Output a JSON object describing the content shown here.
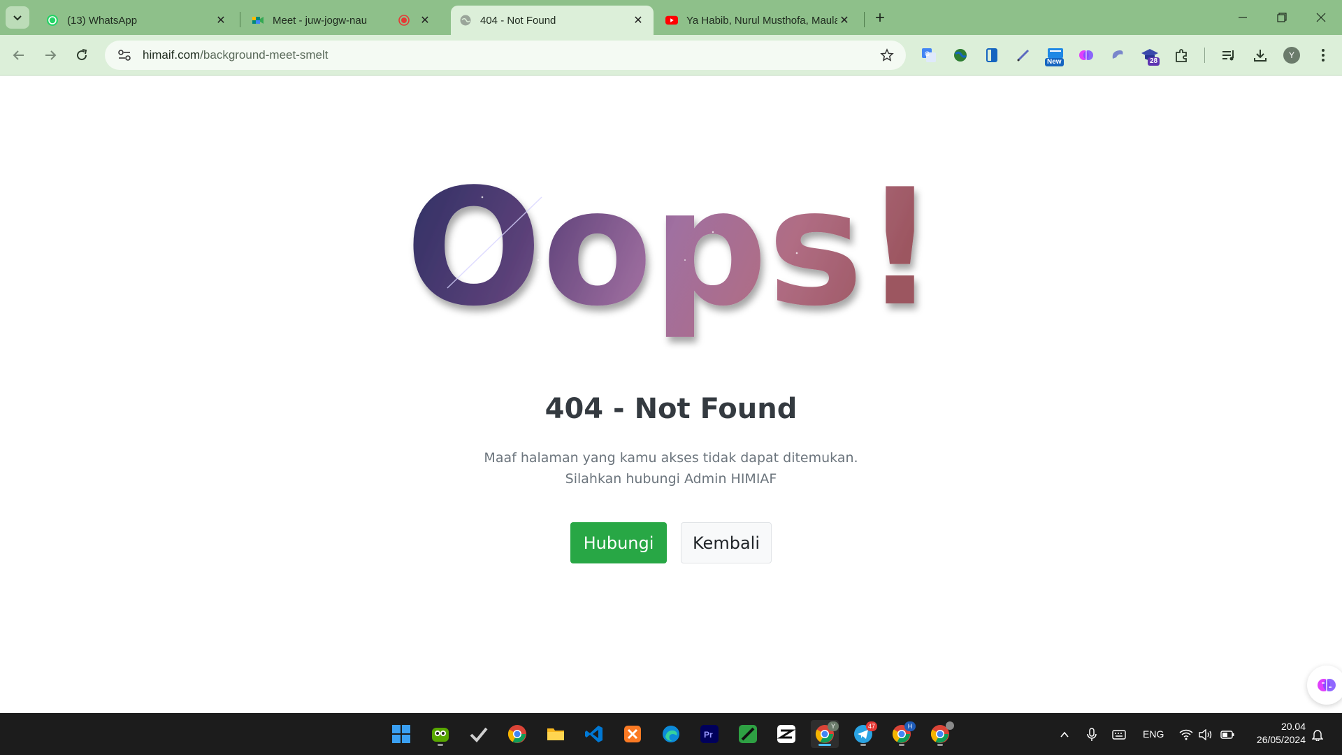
{
  "browser": {
    "tabs": [
      {
        "title": "(13) WhatsApp",
        "icon": "whatsapp-icon",
        "active": false
      },
      {
        "title": "Meet - juw-jogw-nau",
        "icon": "google-meet-icon",
        "active": false,
        "recording": true
      },
      {
        "title": "404 - Not Found",
        "icon": "globe-icon",
        "active": true
      },
      {
        "title": "Ya Habib, Nurul Musthofa, Maulana",
        "icon": "youtube-icon",
        "active": false
      }
    ],
    "address": {
      "host": "himaif.com",
      "path": "/background-meet-smelt"
    },
    "extensions": {
      "new_badge": "New",
      "count_badge": "28"
    },
    "profile_initial": "Y"
  },
  "page": {
    "hero_text": "Oops!",
    "heading": "404 - Not Found",
    "message_line1": "Maaf halaman yang kamu akses tidak dapat ditemukan.",
    "message_line2": "Silahkan hubungi Admin HIMIAF",
    "primary_button": "Hubungi",
    "secondary_button": "Kembali",
    "colors": {
      "primary": "#28a745",
      "heading": "#343a40",
      "muted": "#6c757d"
    }
  },
  "taskbar": {
    "apps": [
      {
        "name": "windows-start",
        "icon": "windows-icon"
      },
      {
        "name": "duolingo-app",
        "icon": "owl-icon"
      },
      {
        "name": "tasks-app",
        "icon": "checkmark-icon"
      },
      {
        "name": "chrome-app",
        "icon": "chrome-icon"
      },
      {
        "name": "file-explorer-app",
        "icon": "folder-icon"
      },
      {
        "name": "vscode-app",
        "icon": "vscode-icon"
      },
      {
        "name": "xampp-app",
        "icon": "xampp-icon"
      },
      {
        "name": "edge-app",
        "icon": "edge-icon"
      },
      {
        "name": "premiere-app",
        "icon": "premiere-icon"
      },
      {
        "name": "notepad-app",
        "icon": "pen-icon"
      },
      {
        "name": "capcut-app",
        "icon": "capcut-icon"
      },
      {
        "name": "chrome-profile-y-app",
        "icon": "chrome-icon",
        "badge": "Y",
        "active": true
      },
      {
        "name": "telegram-app",
        "icon": "telegram-icon",
        "badge": "47"
      },
      {
        "name": "chrome-profile-h-app",
        "icon": "chrome-icon",
        "badge": "H"
      },
      {
        "name": "chrome-profile-other-app",
        "icon": "chrome-icon"
      }
    ],
    "tray": {
      "language": "ENG",
      "time": "20.04",
      "date": "26/05/2024"
    }
  }
}
